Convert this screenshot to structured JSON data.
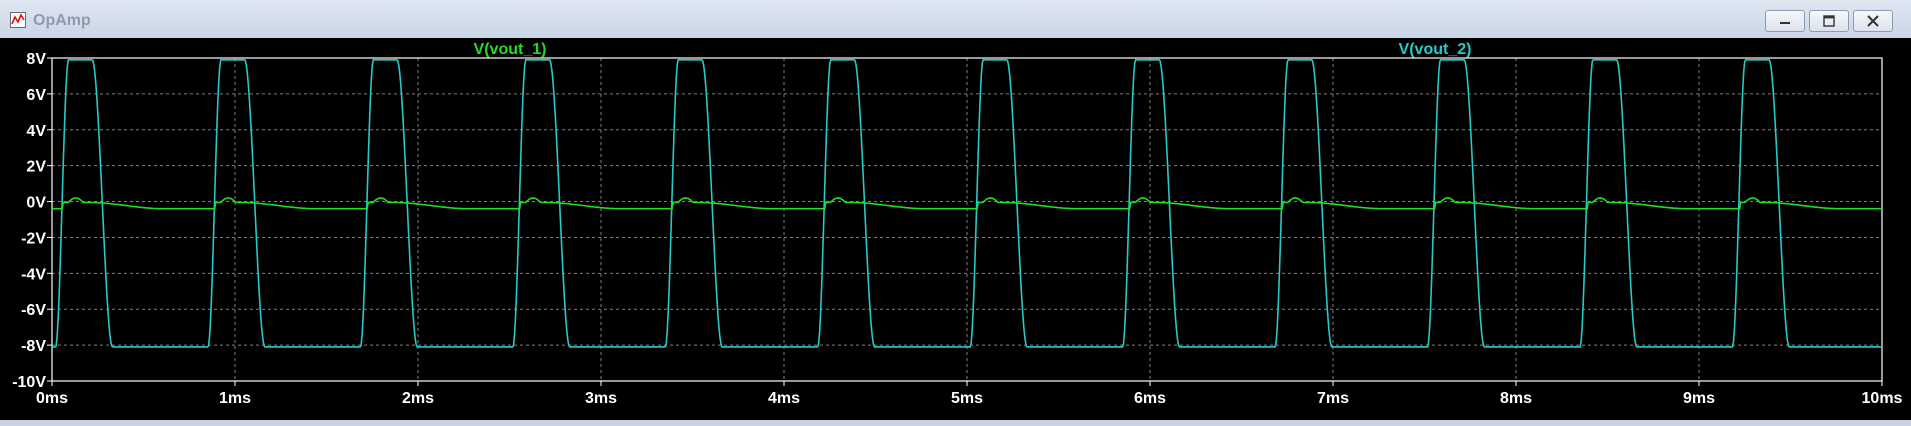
{
  "window": {
    "title": "OpAmp",
    "icons": [
      "waveform-app-icon",
      "minimize-icon",
      "maximize-icon",
      "close-icon"
    ]
  },
  "chart_data": {
    "type": "line",
    "xlabel": "",
    "ylabel": "",
    "x_ticks": [
      "0ms",
      "1ms",
      "2ms",
      "3ms",
      "4ms",
      "5ms",
      "6ms",
      "7ms",
      "8ms",
      "9ms",
      "10ms"
    ],
    "y_ticks": [
      "8V",
      "6V",
      "4V",
      "2V",
      "0V",
      "-2V",
      "-4V",
      "-6V",
      "-8V",
      "-10V"
    ],
    "xlim": [
      0,
      10
    ],
    "ylim": [
      -10,
      8
    ],
    "x_unit": "ms",
    "y_unit": "V",
    "grid": true,
    "series": [
      {
        "name": "V(vout_1)",
        "color": "#22dd22",
        "period_ms": 0.833,
        "low": -0.45,
        "high": 0.2,
        "first_peak_ms": 0.13
      },
      {
        "name": "V(vout_2)",
        "color": "#27c9c9",
        "period_ms": 0.833,
        "low": -8.1,
        "high": 7.9,
        "first_rise_ms": 0.02
      }
    ]
  },
  "colors": {
    "plot_background": "#000000",
    "grid": "#7f7f7f",
    "axis_text": "#ffffff",
    "frame": "#ffffff"
  }
}
